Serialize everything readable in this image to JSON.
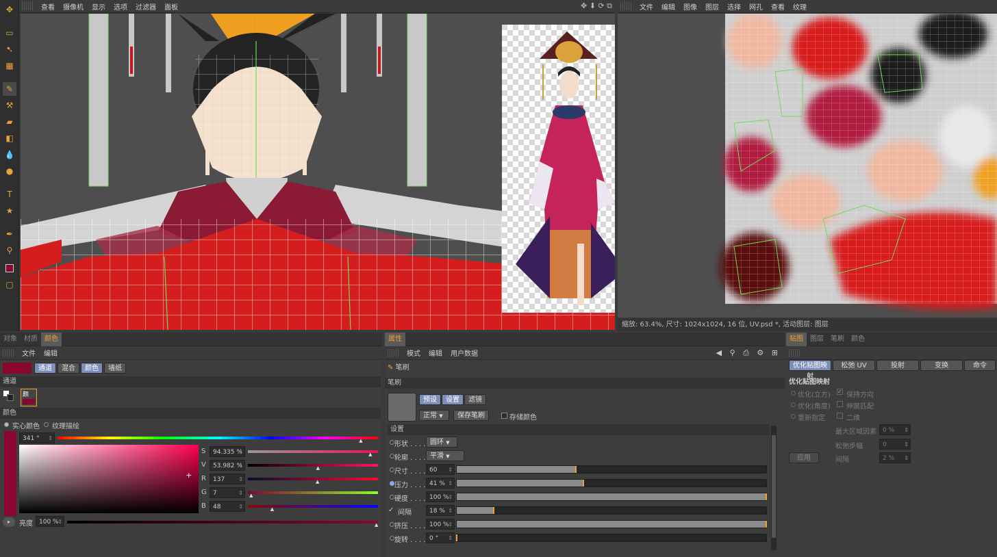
{
  "viewport": {
    "menu": [
      "查看",
      "摄像机",
      "显示",
      "选项",
      "过滤器",
      "面板"
    ]
  },
  "texture_view": {
    "menu": [
      "文件",
      "编辑",
      "图像",
      "图层",
      "选择",
      "网孔",
      "查看",
      "纹理"
    ],
    "status": "缩放: 63.4%, 尺寸: 1024x1024, 16 位, UV.psd *, 活动图层: 图层"
  },
  "color_panel": {
    "tabs": [
      "对象",
      "材质",
      "颜色"
    ],
    "active_tab": "颜色",
    "menu": [
      "文件",
      "编辑"
    ],
    "mode_buttons": [
      "通道",
      "混合",
      "颜色",
      "墙纸"
    ],
    "channel_header": "通道",
    "channel_label": "颜",
    "color_header": "颜色",
    "solid_color": "实心颜色",
    "texture_paint": "纹理描绘",
    "hue_value": "341 °",
    "hue_fraction": 0.947,
    "swatch_color": "#89072f",
    "fields": [
      {
        "label": "S",
        "value": "94.335 %",
        "level": 0.943
      },
      {
        "label": "V",
        "value": "53.982 %",
        "level": 0.54
      },
      {
        "label": "R",
        "value": "137",
        "level": 0.537
      },
      {
        "label": "G",
        "value": "7",
        "level": 0.027
      },
      {
        "label": "B",
        "value": "48",
        "level": 0.188
      }
    ],
    "brightness_label": "亮度",
    "brightness_value": "100 %"
  },
  "attr_panel": {
    "tab": "属性",
    "menu": [
      "模式",
      "编辑",
      "用户数据"
    ],
    "brush_header": "笔刷",
    "brush_section": "笔刷",
    "preset_tabs": [
      "预设",
      "设置",
      "滤镜"
    ],
    "blend_mode": "正常",
    "save_brush": "保存笔刷",
    "store_color": "存储颜色",
    "settings_header": "设置",
    "shape_label": "形状 . . . . .",
    "shape_value": "圆环",
    "outline_label": "轮廓 . . . . .",
    "outline_value": "平滑",
    "sliders": [
      {
        "label": "尺寸 . . . . .",
        "value": "60",
        "level": 0.386
      },
      {
        "label": "压力 . . . . .",
        "value": "41 %",
        "level": 0.41
      },
      {
        "label": "硬度 . . . . .",
        "value": "100 %",
        "level": 1.0
      },
      {
        "label": "间隔",
        "value": "18 %",
        "level": 0.12
      },
      {
        "label": "挤压 . . . . .",
        "value": "100 %",
        "level": 1.0
      },
      {
        "label": "旋转 . . . . .",
        "value": "0 °",
        "level": 0.0
      }
    ]
  },
  "uv_panel": {
    "tabs": [
      "贴图",
      "图层",
      "笔刷",
      "颜色"
    ],
    "active_tab": "贴图",
    "sub_tabs": [
      "优化贴图映射",
      "松弛 UV",
      "投射",
      "变换",
      "命令"
    ],
    "section": "优化贴图映射",
    "radio_opts": [
      "优化(立方)",
      "优化(角度)",
      "重新指定"
    ],
    "checks": [
      "保持方向",
      "伸展匹配",
      "二维"
    ],
    "fields": [
      {
        "label": "最大区域因素",
        "value": "0 %"
      },
      {
        "label": "松弛步幅",
        "value": "0"
      },
      {
        "label": "间隔",
        "value": "2 %"
      }
    ],
    "apply": "应用"
  }
}
